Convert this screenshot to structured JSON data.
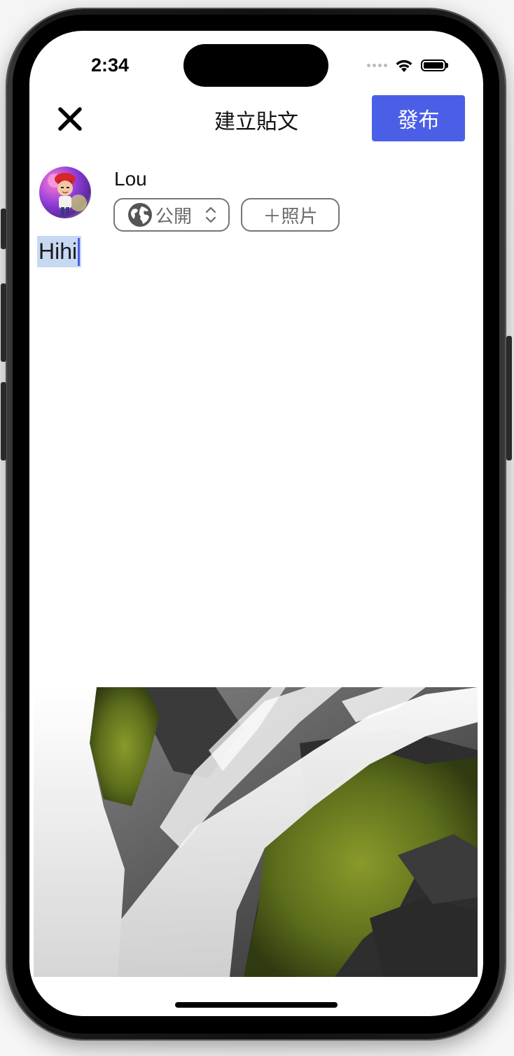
{
  "status_bar": {
    "time": "2:34"
  },
  "header": {
    "title": "建立貼文",
    "publish_label": "發布"
  },
  "user": {
    "name": "Lou"
  },
  "privacy": {
    "label": "公開"
  },
  "add_photo": {
    "label": "＋照片"
  },
  "post": {
    "text": "Hihi"
  },
  "icons": {
    "close": "close-icon",
    "globe": "globe-icon",
    "chevron": "chevron-up-down-icon",
    "wifi": "wifi-icon",
    "battery": "battery-icon"
  },
  "colors": {
    "accent": "#4b5fe6",
    "selection": "#c7d8f3"
  }
}
